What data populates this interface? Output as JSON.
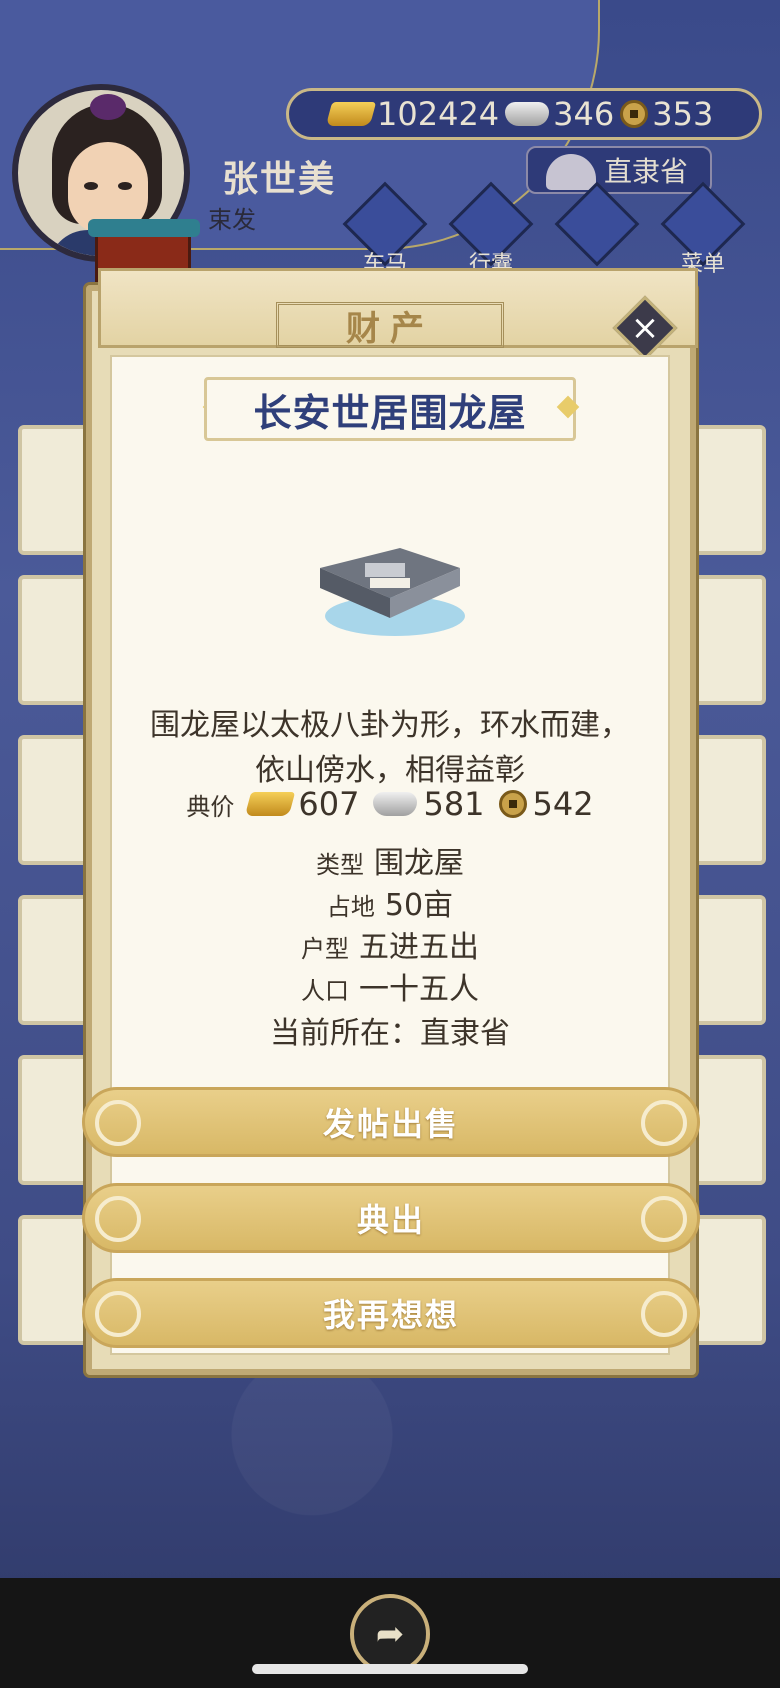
{
  "player": {
    "name": "张世美",
    "title": "束发"
  },
  "currency": {
    "gold": "102424",
    "silver": "346",
    "copper": "353"
  },
  "location": "直隶省",
  "menu": [
    {
      "label": "车马",
      "icon": "carriage-icon"
    },
    {
      "label": "行囊",
      "icon": "bag-icon"
    },
    {
      "label": "",
      "icon": "book-icon"
    },
    {
      "label": "菜单",
      "icon": "menu-dots-icon"
    }
  ],
  "modal": {
    "header": "财产",
    "property_name": "长安世居围龙屋",
    "description_line1": "围龙屋以太极八卦为形，环水而建，",
    "description_line2": "依山傍水，相得益彰",
    "price_label": "典价",
    "price_gold": "607",
    "price_silver": "581",
    "price_copper": "542",
    "info": [
      {
        "key": "类型",
        "value": "围龙屋"
      },
      {
        "key": "占地",
        "value": "50亩"
      },
      {
        "key": "户型",
        "value": "五进五出"
      },
      {
        "key": "人口",
        "value": "一十五人"
      }
    ],
    "current_location": "当前所在：直隶省",
    "buttons": {
      "sell": "发帖出售",
      "pawn": "典出",
      "cancel": "我再想想"
    }
  },
  "colors": {
    "background": "#3f4c86",
    "panel": "#fbf8ee",
    "title_blue": "#2f3f7a",
    "button_gold": "#d8b866"
  }
}
